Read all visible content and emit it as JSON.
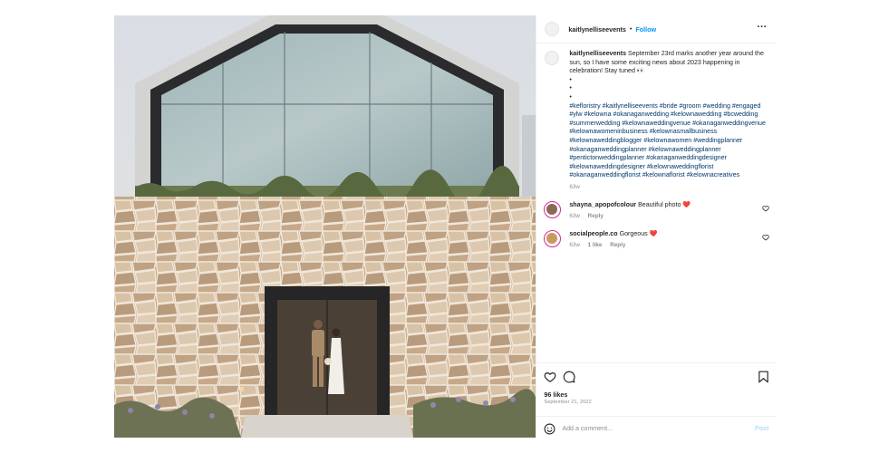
{
  "post": {
    "username": "kaitlynelliseevents",
    "follow_label": "Follow",
    "separator": "•",
    "more_icon": "more-horizontal-icon",
    "caption": {
      "username": "kaitlynelliseevents",
      "text": "September 23rd marks another year around the sun, so I have some exciting news about 2023 happening in celebration! Stay tuned 👀",
      "bullets": [
        "•",
        "•",
        "•"
      ],
      "hashtags": [
        "#kefloristry",
        "#kaitlynelliseevents",
        "#bride",
        "#groom",
        "#wedding",
        "#engaged",
        "#ylw",
        "#kelowna",
        "#okanaganwedding",
        "#kelownawedding",
        "#bcwedding",
        "#summerwedding",
        "#kelownaweddingvenue",
        "#okanaganweddingvenue",
        "#kelownawomeninbusiness",
        "#kelownasmallbusiness",
        "#kelownaweddingblogger",
        "#kelownawomen",
        "#weddingplanner",
        "#okanaganweddingplanner",
        "#kelownaweddingplanner",
        "#pentictonweddingplanner",
        "#okanaganweddingdesigner",
        "#kelownaweddingdesigner",
        "#kelownaweddingflorist",
        "#okanaganweddingflorist",
        "#kelownaflorist",
        "#kelownacreatives"
      ],
      "time": "63w"
    },
    "comments": [
      {
        "username": "shayna_apopofcolour",
        "text": "Beautiful photo",
        "emoji": "❤️",
        "time": "63w",
        "likes": "",
        "reply_label": "Reply",
        "avatar_color": "#8a6a55"
      },
      {
        "username": "socialpeople.co",
        "text": "Gorgeous",
        "emoji": "❤️",
        "time": "63w",
        "likes": "1 like",
        "reply_label": "Reply",
        "avatar_color": "#c79a5e"
      }
    ],
    "likes": "96 likes",
    "date": "September 21, 2022",
    "add_comment_placeholder": "Add a comment...",
    "post_button": "Post",
    "colors": {
      "link": "#0095f6",
      "hashtag": "#00376b",
      "muted": "#8e8e8e",
      "heart": "#ed4956",
      "post_disabled": "#b2dffc"
    }
  }
}
